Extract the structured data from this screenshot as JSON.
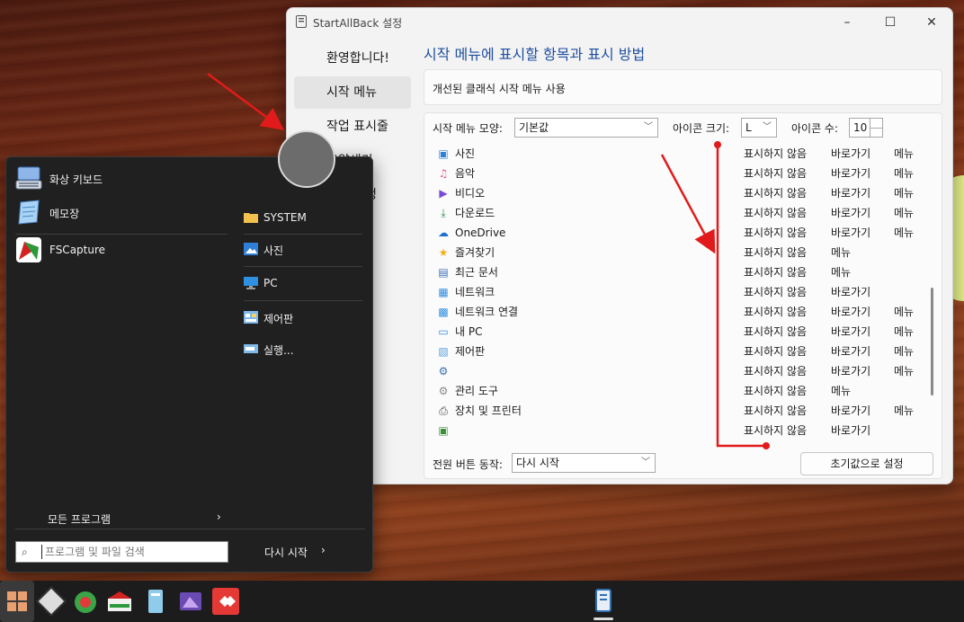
{
  "window": {
    "title": "StartAllBack 설정",
    "controls": {
      "minimize": "–",
      "maximize": "☐",
      "close": "✕"
    },
    "nav": [
      {
        "label": "환영합니다!"
      },
      {
        "label": "시작 메뉴"
      },
      {
        "label": "작업 표시줄"
      },
      {
        "label": "모양새기"
      },
      {
        "label": "고급 설정"
      }
    ],
    "heading": "시작 메뉴에 표시할 항목과 표시 방법",
    "classic": {
      "label": "개선된 클래식 시작 메뉴 사용",
      "value": "켬"
    },
    "style_label": "시작 메뉴 모양:",
    "style_value": "기본값",
    "icon_size_label": "아이콘 크기:",
    "icon_size_value": "L",
    "icon_count_label": "아이콘 수:",
    "icon_count_value": "10",
    "items": [
      {
        "icon": "pictures-icon",
        "name": "사진",
        "col1": "표시하지 않음",
        "col2": "바로가기",
        "col3": "메뉴"
      },
      {
        "icon": "music-icon",
        "name": "음악",
        "col1": "표시하지 않음",
        "col2": "바로가기",
        "col3": "메뉴"
      },
      {
        "icon": "video-icon",
        "name": "비디오",
        "col1": "표시하지 않음",
        "col2": "바로가기",
        "col3": "메뉴"
      },
      {
        "icon": "download-icon",
        "name": "다운로드",
        "col1": "표시하지 않음",
        "col2": "바로가기",
        "col3": "메뉴"
      },
      {
        "icon": "onedrive-icon",
        "name": "OneDrive",
        "col1": "표시하지 않음",
        "col2": "바로가기",
        "col3": "메뉴"
      },
      {
        "icon": "star-icon",
        "name": "즐겨찾기",
        "col1": "표시하지 않음",
        "col2": "메뉴",
        "col3": ""
      },
      {
        "icon": "recent-docs-icon",
        "name": "최근 문서",
        "col1": "표시하지 않음",
        "col2": "메뉴",
        "col3": ""
      },
      {
        "icon": "network-icon",
        "name": "네트워크",
        "col1": "표시하지 않음",
        "col2": "바로가기",
        "col3": ""
      },
      {
        "icon": "network-connection-icon",
        "name": "네트워크 연결",
        "col1": "표시하지 않음",
        "col2": "바로가기",
        "col3": "메뉴"
      },
      {
        "icon": "computer-icon",
        "name": "내 PC",
        "col1": "표시하지 않음",
        "col2": "바로가기",
        "col3": "메뉴"
      },
      {
        "icon": "control-panel-icon",
        "name": "제어판",
        "col1": "표시하지 않음",
        "col2": "바로가기",
        "col3": "메뉴"
      },
      {
        "icon": "settings-gear-icon",
        "name": "",
        "col1": "표시하지 않음",
        "col2": "바로가기",
        "col3": "메뉴"
      },
      {
        "icon": "admin-tools-icon",
        "name": "관리 도구",
        "col1": "표시하지 않음",
        "col2": "메뉴",
        "col3": ""
      },
      {
        "icon": "printer-icon",
        "name": "장치 및 프린터",
        "col1": "표시하지 않음",
        "col2": "바로가기",
        "col3": "메뉴"
      },
      {
        "icon": "window-icon",
        "name": "",
        "col1": "표시하지 않음",
        "col2": "바로가기",
        "col3": ""
      }
    ],
    "power_label": "전원 버튼 동작:",
    "power_value": "다시 시작",
    "reset_label": "초기값으로 설정"
  },
  "start_menu": {
    "pinned": [
      {
        "label": "화상 키보드",
        "icon": "keyboard-icon"
      },
      {
        "label": "메모장",
        "icon": "notepad-icon"
      },
      {
        "label": "FSCapture",
        "icon": "fscapture-icon"
      }
    ],
    "right": [
      {
        "label": "SYSTEM",
        "icon": "folder-icon"
      },
      {
        "label": "사진",
        "icon": "pictures-icon"
      },
      {
        "label": "PC",
        "icon": "computer-icon"
      },
      {
        "label": "제어판",
        "icon": "control-panel-icon"
      },
      {
        "label": "실행...",
        "icon": "run-icon"
      }
    ],
    "all_programs": "모든 프로그램",
    "search_placeholder": "프로그램 및 파일 검색",
    "restart": "다시 시작"
  },
  "taskbar": {
    "apps": [
      "start-icon",
      "app-icon",
      "app-icon",
      "fscapture-icon",
      "app-icon",
      "app-icon",
      "app-icon",
      "startallback-icon"
    ]
  },
  "colors": {
    "heading": "#1f4fa0",
    "annotation": "#e11b1b",
    "menu_bg": "#202020"
  }
}
